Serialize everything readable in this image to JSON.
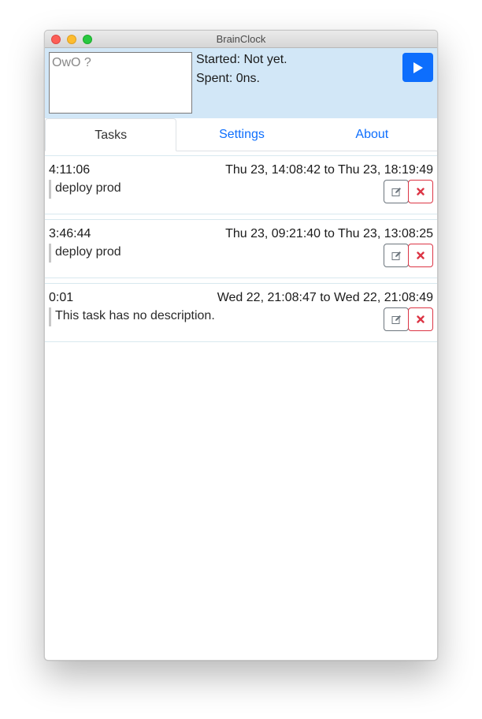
{
  "window": {
    "title": "BrainClock"
  },
  "top_panel": {
    "input_placeholder": "OwO ?",
    "started": "Started: Not yet.",
    "spent": "Spent: 0ns.",
    "play_icon": "play-icon"
  },
  "tabs": [
    {
      "label": "Tasks",
      "active": true
    },
    {
      "label": "Settings",
      "active": false
    },
    {
      "label": "About",
      "active": false
    }
  ],
  "tasks": [
    {
      "duration": "4:11:06",
      "range": "Thu 23, 14:08:42 to Thu 23, 18:19:49",
      "description": "deploy prod"
    },
    {
      "duration": "3:46:44",
      "range": "Thu 23, 09:21:40 to Thu 23, 13:08:25",
      "description": "deploy prod"
    },
    {
      "duration": "0:01",
      "range": "Wed 22, 21:08:47 to Wed 22, 21:08:49",
      "description": "This task has no description."
    }
  ],
  "colors": {
    "accent": "#0d6efd",
    "panel_bg": "#d2e7f7",
    "danger": "#dc3545",
    "secondary": "#6c757d"
  }
}
